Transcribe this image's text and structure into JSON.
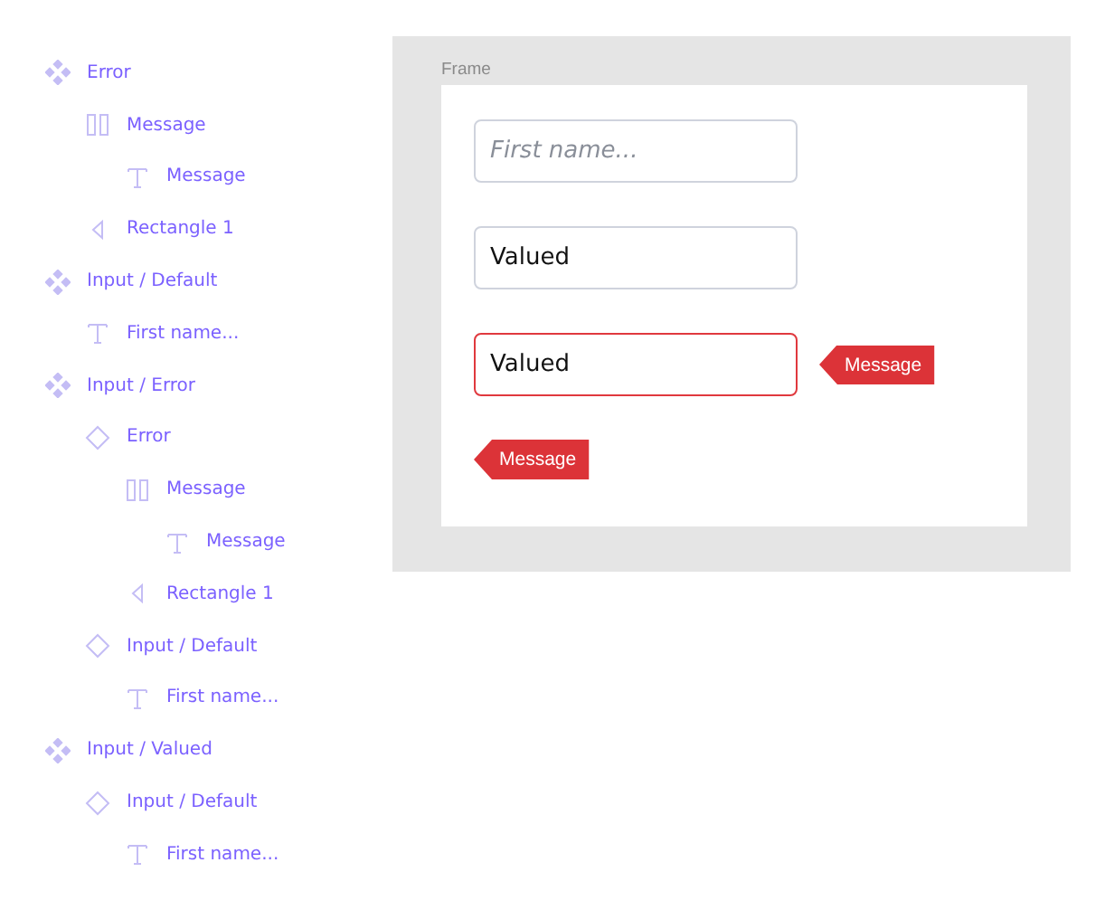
{
  "layers": [
    {
      "kind": "component",
      "name": "Error",
      "children": [
        {
          "kind": "autolayout",
          "name": "Message",
          "children": [
            {
              "kind": "text",
              "name": "Message"
            }
          ]
        },
        {
          "kind": "vector",
          "name": "Rectangle 1"
        }
      ]
    },
    {
      "kind": "component",
      "name": "Input / Default",
      "children": [
        {
          "kind": "text",
          "name": "First name..."
        }
      ]
    },
    {
      "kind": "component",
      "name": "Input / Error",
      "children": [
        {
          "kind": "instance",
          "name": "Error",
          "children": [
            {
              "kind": "autolayout",
              "name": "Message",
              "children": [
                {
                  "kind": "text",
                  "name": "Message"
                }
              ]
            },
            {
              "kind": "vector",
              "name": "Rectangle 1"
            }
          ]
        },
        {
          "kind": "instance",
          "name": "Input / Default",
          "children": [
            {
              "kind": "text",
              "name": "First name..."
            }
          ]
        }
      ]
    },
    {
      "kind": "component",
      "name": "Input / Valued",
      "children": [
        {
          "kind": "instance",
          "name": "Input / Default",
          "children": [
            {
              "kind": "text",
              "name": "First name..."
            }
          ]
        }
      ]
    }
  ],
  "canvas": {
    "frame_label": "Frame",
    "inputs": [
      {
        "placeholder": "First name...",
        "error": false
      },
      {
        "value": "Valued",
        "error": false
      },
      {
        "value": "Valued",
        "error": true,
        "message": "Message"
      }
    ],
    "tag": "Message"
  }
}
